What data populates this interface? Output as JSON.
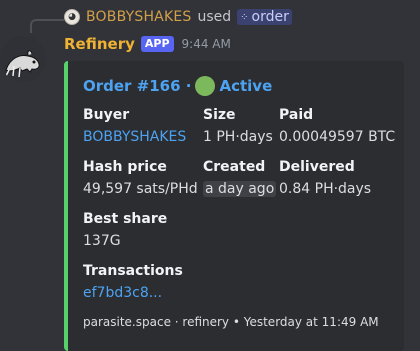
{
  "reply": {
    "username": "BOBBYSHAKES",
    "used_text": "used",
    "command": "order"
  },
  "message": {
    "bot_name": "Refinery",
    "badge": "APP",
    "time": "9:44 AM"
  },
  "embed": {
    "accent_color": "#57d16a",
    "title_prefix": "Order #166 ·",
    "status": "Active",
    "status_color": "#7cb95c",
    "fields": {
      "buyer": {
        "name": "Buyer",
        "value": "BOBBYSHAKES"
      },
      "size": {
        "name": "Size",
        "value": "1 PH·days"
      },
      "paid": {
        "name": "Paid",
        "value": "0.00049597 BTC"
      },
      "hash_price": {
        "name": "Hash price",
        "value": "49,597 sats/PHd"
      },
      "created": {
        "name": "Created",
        "value": "a day ago"
      },
      "delivered": {
        "name": "Delivered",
        "value": "0.84 PH·days"
      },
      "best_share": {
        "name": "Best share",
        "value": "137G"
      },
      "transactions": {
        "name": "Transactions",
        "value": "ef7bd3c8..."
      }
    },
    "footer": "parasite.space · refinery • Yesterday at 11:49 AM"
  }
}
